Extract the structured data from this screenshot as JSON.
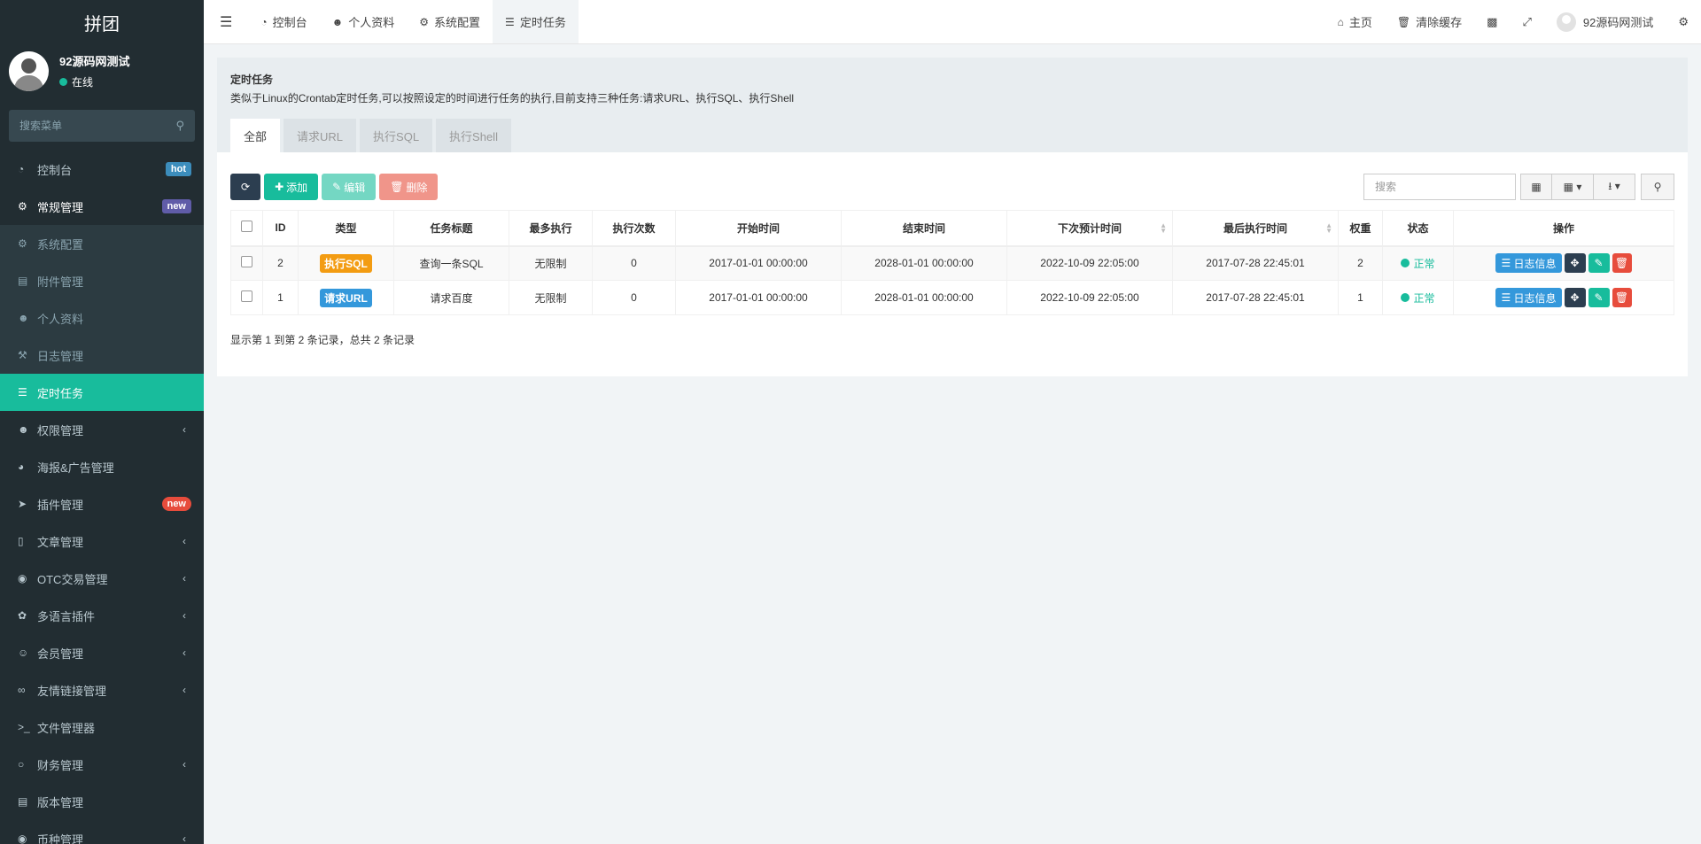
{
  "sidebar": {
    "brand": "拼团",
    "user": {
      "name": "92源码网测试",
      "status": "在线"
    },
    "search_placeholder": "搜索菜单",
    "items": [
      {
        "label": "控制台",
        "icon": "dashboard-icon",
        "badge": "hot"
      },
      {
        "label": "常规管理",
        "icon": "cogs-icon",
        "badge": "new"
      },
      {
        "label": "系统配置",
        "icon": "gear-icon"
      },
      {
        "label": "附件管理",
        "icon": "file-image-icon"
      },
      {
        "label": "个人资料",
        "icon": "user-icon"
      },
      {
        "label": "日志管理",
        "icon": "gavel-icon"
      },
      {
        "label": "定时任务",
        "icon": "tasks-icon"
      },
      {
        "label": "权限管理",
        "icon": "group-icon"
      },
      {
        "label": "海报&广告管理",
        "icon": "pie-chart-icon"
      },
      {
        "label": "插件管理",
        "icon": "rocket-icon",
        "badge": "new"
      },
      {
        "label": "文章管理",
        "icon": "folder-open-icon"
      },
      {
        "label": "OTC交易管理",
        "icon": "money-icon"
      },
      {
        "label": "多语言插件",
        "icon": "leaf-icon"
      },
      {
        "label": "会员管理",
        "icon": "user-circle-icon"
      },
      {
        "label": "友情链接管理",
        "icon": "link-icon"
      },
      {
        "label": "文件管理器",
        "icon": "terminal-icon"
      },
      {
        "label": "财务管理",
        "icon": "circle-icon"
      },
      {
        "label": "版本管理",
        "icon": "file-text-icon"
      },
      {
        "label": "币种管理",
        "icon": "coin-icon"
      }
    ]
  },
  "header": {
    "tabs": [
      {
        "label": "控制台",
        "icon": "dashboard-icon"
      },
      {
        "label": "个人资料",
        "icon": "user-icon"
      },
      {
        "label": "系统配置",
        "icon": "gear-icon"
      },
      {
        "label": "定时任务",
        "icon": "tasks-icon"
      }
    ],
    "right": {
      "home": "主页",
      "clear_cache": "清除缓存",
      "user_name": "92源码网测试"
    }
  },
  "panel": {
    "title": "定时任务",
    "description": "类似于Linux的Crontab定时任务,可以按照设定的时间进行任务的执行,目前支持三种任务:请求URL、执行SQL、执行Shell",
    "tabs": [
      "全部",
      "请求URL",
      "执行SQL",
      "执行Shell"
    ],
    "toolbar": {
      "add": "添加",
      "edit": "编辑",
      "delete": "删除"
    },
    "search_placeholder": "搜索"
  },
  "table": {
    "headers": [
      "ID",
      "类型",
      "任务标题",
      "最多执行",
      "执行次数",
      "开始时间",
      "结束时间",
      "下次预计时间",
      "最后执行时间",
      "权重",
      "状态",
      "操作"
    ],
    "rows": [
      {
        "id": "2",
        "type": "执行SQL",
        "title": "查询一条SQL",
        "max": "无限制",
        "count": "0",
        "start": "2017-01-01 00:00:00",
        "end": "2028-01-01 00:00:00",
        "next": "2022-10-09 22:05:00",
        "last": "2017-07-28 22:45:01",
        "weight": "2",
        "status": "正常",
        "log": "日志信息"
      },
      {
        "id": "1",
        "type": "请求URL",
        "title": "请求百度",
        "max": "无限制",
        "count": "0",
        "start": "2017-01-01 00:00:00",
        "end": "2028-01-01 00:00:00",
        "next": "2022-10-09 22:05:00",
        "last": "2017-07-28 22:45:01",
        "weight": "1",
        "status": "正常",
        "log": "日志信息"
      }
    ],
    "footer": "显示第 1 到第 2 条记录，总共 2 条记录"
  },
  "colors": {
    "accent": "#18bc9c",
    "sidebar_bg": "#222d32",
    "danger": "#e74c3c",
    "info": "#3498db",
    "warning": "#f39c12"
  }
}
